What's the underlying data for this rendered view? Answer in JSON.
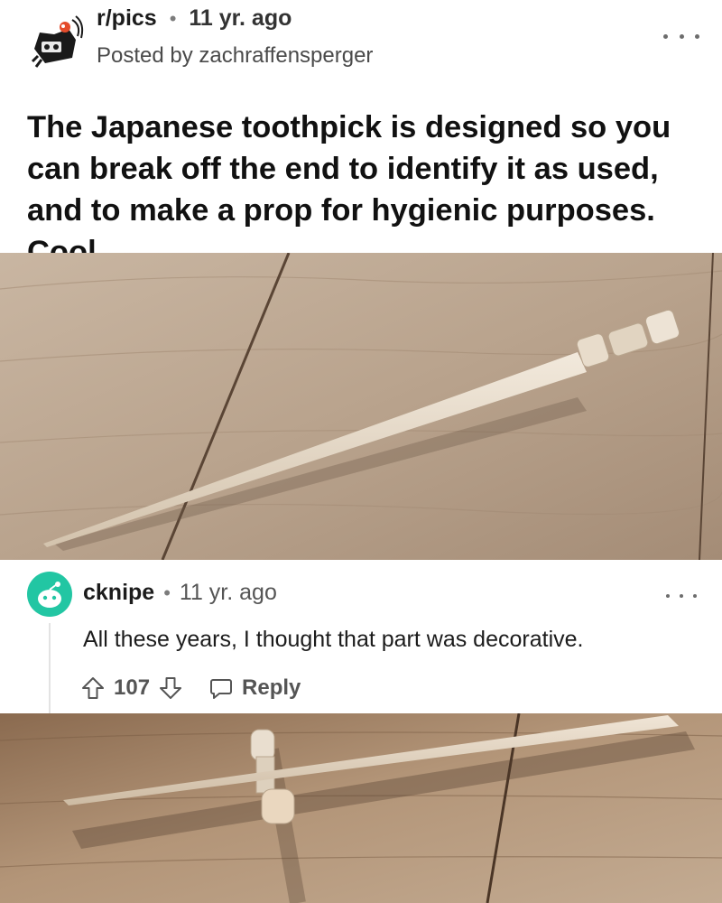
{
  "post": {
    "subreddit": "r/pics",
    "age": "11 yr. ago",
    "author_line": "Posted by zachraffensperger",
    "title": "The Japanese toothpick is designed so you can break off the end to identify it as used, and to make a prop for hygienic purposes. Cool."
  },
  "comment": {
    "author": "cknipe",
    "age": "11 yr. ago",
    "body": "All these years, I thought that part was decorative.",
    "score": "107",
    "reply_label": "Reply"
  },
  "icons": {
    "subreddit_avatar": "reddit-snoo-icon",
    "post_menu": "more-options-icon",
    "comment_avatar": "snoo-avatar-icon",
    "comment_menu": "more-options-icon",
    "upvote": "arrow-up-icon",
    "downvote": "arrow-down-icon",
    "reply": "chat-bubble-icon"
  },
  "colors": {
    "comment_avatar_bg": "#22c6a3",
    "wood_base": "#b8a088",
    "toothpick": "#e2d6c4"
  }
}
